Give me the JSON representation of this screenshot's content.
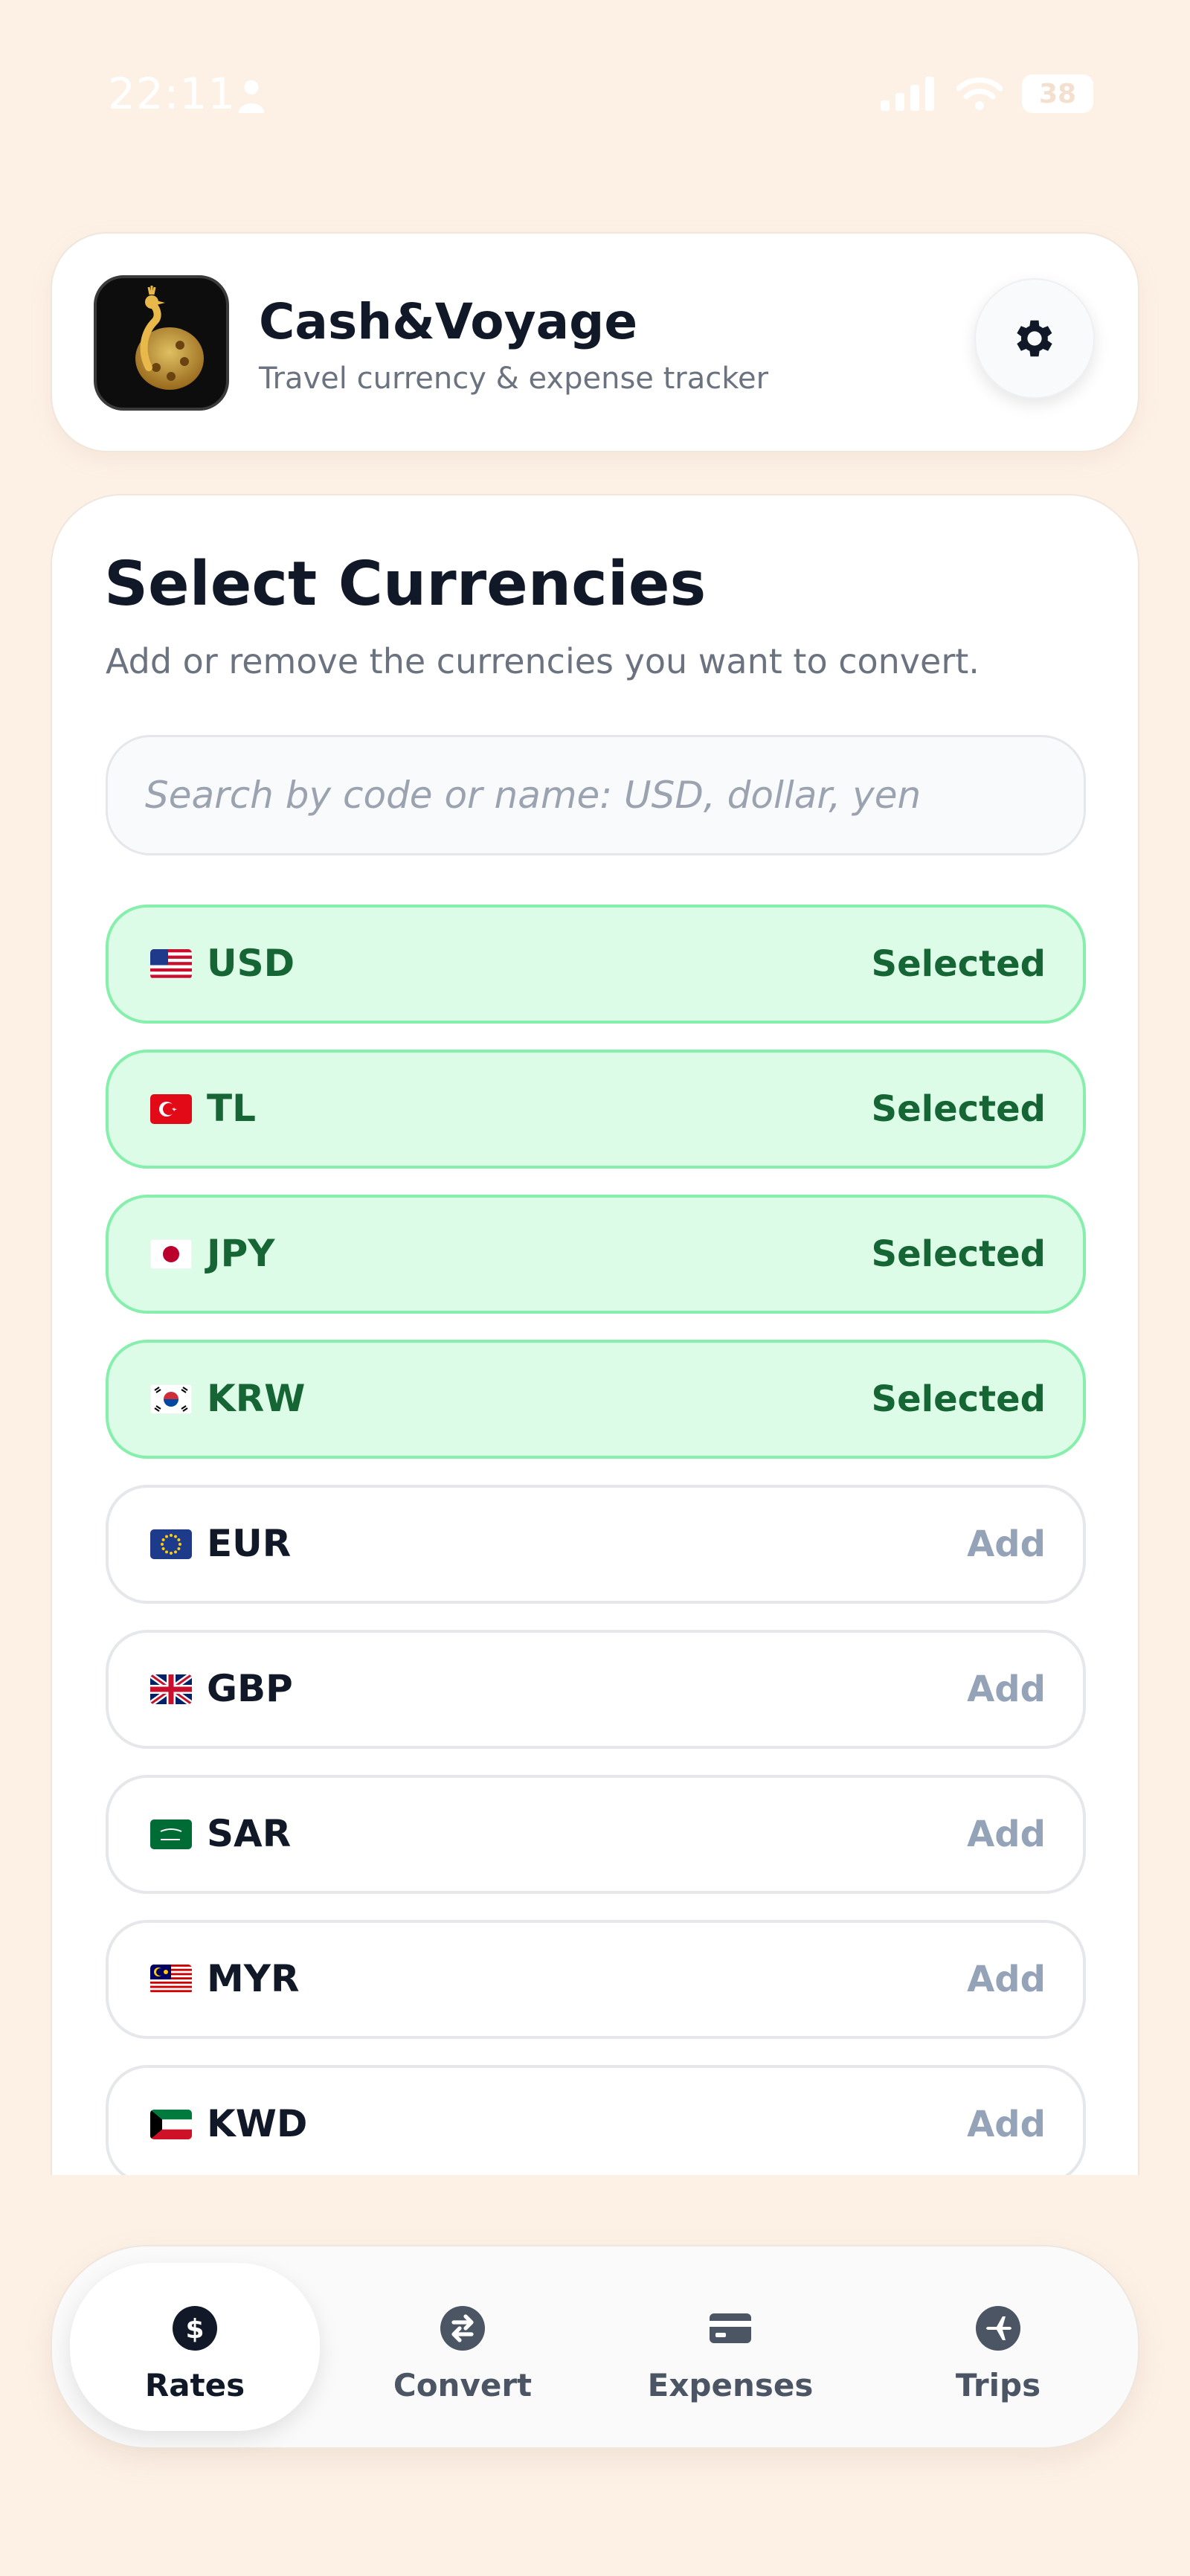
{
  "status_bar": {
    "time": "22:11",
    "battery": "38"
  },
  "header": {
    "title": "Cash&Voyage",
    "subtitle": "Travel currency & expense tracker",
    "logo_icon": "peacock-logo",
    "settings_icon": "gear-icon"
  },
  "section": {
    "title": "Select Currencies",
    "subtitle": "Add or remove the currencies you want to convert."
  },
  "search": {
    "placeholder": "Search by code or name: USD, dollar, yen",
    "value": ""
  },
  "currencies": [
    {
      "code": "USD",
      "flag": "us-flag",
      "status": "Selected",
      "selected": true
    },
    {
      "code": "TL",
      "flag": "tr-flag",
      "status": "Selected",
      "selected": true
    },
    {
      "code": "JPY",
      "flag": "jp-flag",
      "status": "Selected",
      "selected": true
    },
    {
      "code": "KRW",
      "flag": "kr-flag",
      "status": "Selected",
      "selected": true
    },
    {
      "code": "EUR",
      "flag": "eu-flag",
      "status": "Add",
      "selected": false
    },
    {
      "code": "GBP",
      "flag": "gb-flag",
      "status": "Add",
      "selected": false
    },
    {
      "code": "SAR",
      "flag": "sa-flag",
      "status": "Add",
      "selected": false
    },
    {
      "code": "MYR",
      "flag": "my-flag",
      "status": "Add",
      "selected": false
    },
    {
      "code": "KWD",
      "flag": "kw-flag",
      "status": "Add",
      "selected": false
    }
  ],
  "nav": [
    {
      "label": "Rates",
      "icon": "dollar-icon",
      "active": true
    },
    {
      "label": "Convert",
      "icon": "exchange-icon",
      "active": false
    },
    {
      "label": "Expenses",
      "icon": "card-icon",
      "active": false
    },
    {
      "label": "Trips",
      "icon": "plane-icon",
      "active": false
    }
  ],
  "colors": {
    "background": "#fdf1e6",
    "selected_bg": "#dcfce7",
    "selected_border": "#86efac",
    "selected_text": "#166534",
    "add_text": "#94a3b8"
  }
}
